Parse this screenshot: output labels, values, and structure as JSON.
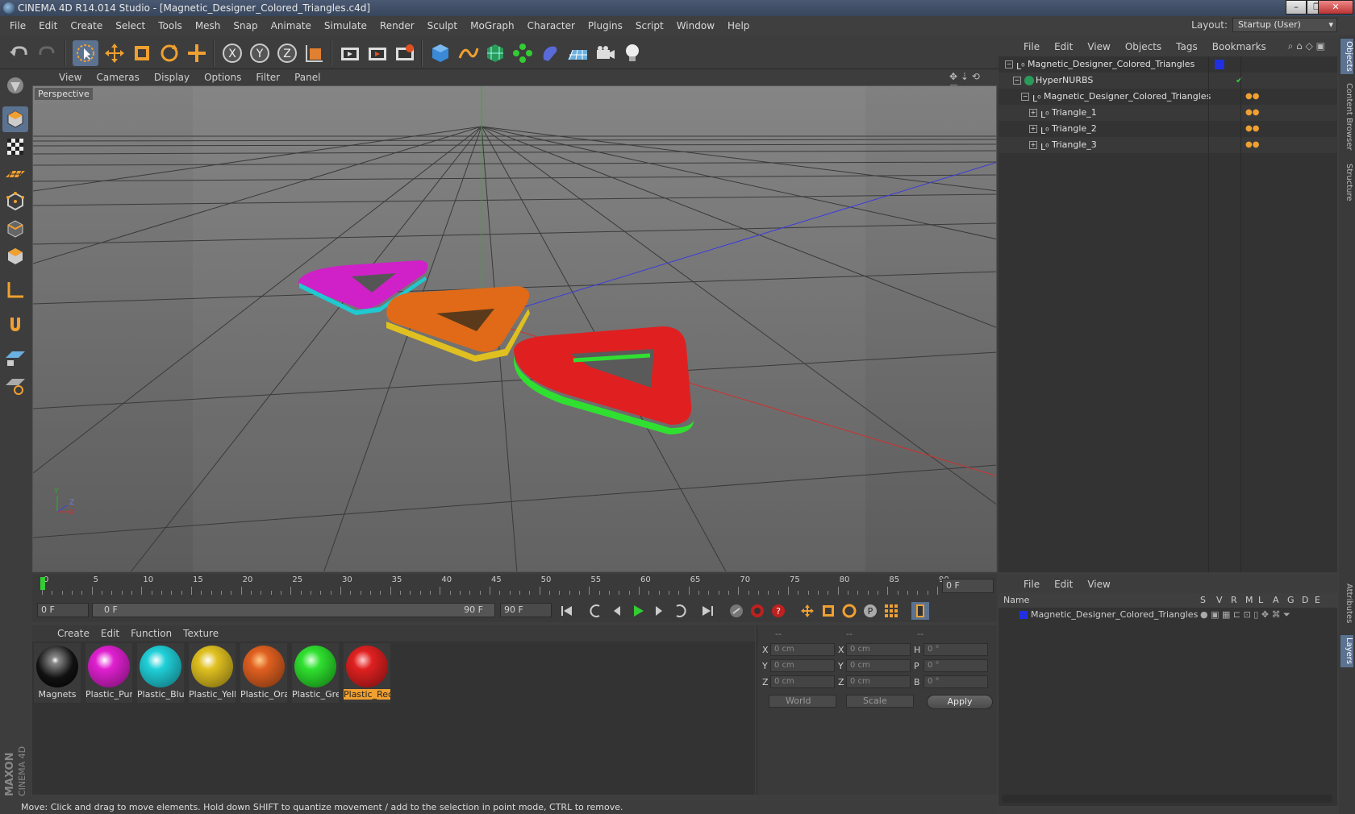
{
  "window": {
    "title": "CINEMA 4D R14.014 Studio - [Magnetic_Designer_Colored_Triangles.c4d]"
  },
  "menu": [
    "File",
    "Edit",
    "Create",
    "Select",
    "Tools",
    "Mesh",
    "Snap",
    "Animate",
    "Simulate",
    "Render",
    "Sculpt",
    "MoGraph",
    "Character",
    "Plugins",
    "Script",
    "Window",
    "Help"
  ],
  "layout": {
    "label": "Layout:",
    "value": "Startup (User)"
  },
  "viewport": {
    "menu": [
      "View",
      "Cameras",
      "Display",
      "Options",
      "Filter",
      "Panel"
    ],
    "label": "Perspective",
    "axis_labels": {
      "y": "Y",
      "z": "Z",
      "x": "X"
    }
  },
  "timeline": {
    "ticks": [
      "0",
      "5",
      "10",
      "15",
      "20",
      "25",
      "30",
      "35",
      "40",
      "45",
      "50",
      "55",
      "60",
      "65",
      "70",
      "75",
      "80",
      "85",
      "90"
    ],
    "current_frame": "0 F"
  },
  "playback": {
    "start": "0 F",
    "range_start": "0 F",
    "range_end": "90 F",
    "end": "90 F"
  },
  "materials": {
    "menu": [
      "Create",
      "Edit",
      "Function",
      "Texture"
    ],
    "items": [
      {
        "label": "Magnets",
        "color": "#222222"
      },
      {
        "label": "Plastic_Purp",
        "color": "#e020d0"
      },
      {
        "label": "Plastic_Blue",
        "color": "#20d0d8"
      },
      {
        "label": "Plastic_Yellow",
        "color": "#e0c020"
      },
      {
        "label": "Plastic_Orange",
        "color": "#e06020"
      },
      {
        "label": "Plastic_Green",
        "color": "#30e030"
      },
      {
        "label": "Plastic_Red",
        "color": "#e02020"
      }
    ]
  },
  "coordinates": {
    "header": [
      "--",
      "--",
      "--"
    ],
    "rows": [
      {
        "l1": "X",
        "v1": "0 cm",
        "l2": "X",
        "v2": "0 cm",
        "l3": "H",
        "v3": "0 °"
      },
      {
        "l1": "Y",
        "v1": "0 cm",
        "l2": "Y",
        "v2": "0 cm",
        "l3": "P",
        "v3": "0 °"
      },
      {
        "l1": "Z",
        "v1": "0 cm",
        "l2": "Z",
        "v2": "0 cm",
        "l3": "B",
        "v3": "0 °"
      }
    ],
    "space": "World",
    "mode": "Scale",
    "apply": "Apply"
  },
  "objects": {
    "menu": [
      "File",
      "Edit",
      "View",
      "Objects",
      "Tags",
      "Bookmarks"
    ],
    "rows": [
      {
        "name": "Magnetic_Designer_Colored_Triangles"
      },
      {
        "name": "HyperNURBS"
      },
      {
        "name": "Magnetic_Designer_Colored_Triangles"
      },
      {
        "name": "Triangle_1"
      },
      {
        "name": "Triangle_2"
      },
      {
        "name": "Triangle_3"
      }
    ]
  },
  "layers": {
    "menu": [
      "File",
      "Edit",
      "View"
    ],
    "header_name": "Name",
    "columns": [
      "S",
      "V",
      "R",
      "M",
      "L",
      "A",
      "G",
      "D",
      "E"
    ],
    "row": "Magnetic_Designer_Colored_Triangles"
  },
  "side_tabs": [
    "Objects",
    "Content Browser",
    "Structure",
    "Attributes",
    "Layers"
  ],
  "brand": "MAXON CINEMA 4D",
  "status": "Move: Click and drag to move elements. Hold down SHIFT to quantize movement / add to the selection in point mode, CTRL to remove."
}
